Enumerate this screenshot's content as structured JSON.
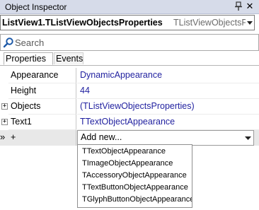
{
  "window": {
    "title": "Object Inspector",
    "pin_icon": "pin-icon",
    "close_icon": "close-icon"
  },
  "object_selector": {
    "name": "ListView1.TListViewObjectsProperties",
    "type": "TListViewObjectsP"
  },
  "search": {
    "placeholder": "Search",
    "value": ""
  },
  "tabs": [
    {
      "label": "Properties",
      "active": true
    },
    {
      "label": "Events",
      "active": false
    }
  ],
  "properties": [
    {
      "name": "Appearance",
      "value": "DynamicAppearance",
      "expandable": false
    },
    {
      "name": "Height",
      "value": "44",
      "expandable": false
    },
    {
      "name": "Objects",
      "value": "(TListViewObjectsProperties)",
      "expandable": true
    },
    {
      "name": "Text1",
      "value": "TTextObjectAppearance",
      "expandable": true
    }
  ],
  "selected_row": {
    "marker": "»",
    "name": "+",
    "value": "Add new..."
  },
  "dropdown_items": [
    "TTextObjectAppearance",
    "TImageObjectAppearance",
    "TAccessoryObjectAppearance",
    "TTextButtonObjectAppearance",
    "TGlyphButtonObjectAppearance"
  ],
  "colors": {
    "value_text": "#1f1f9f",
    "titlebar": "#d6dbe9",
    "search_icon": "#1e5aa8"
  }
}
